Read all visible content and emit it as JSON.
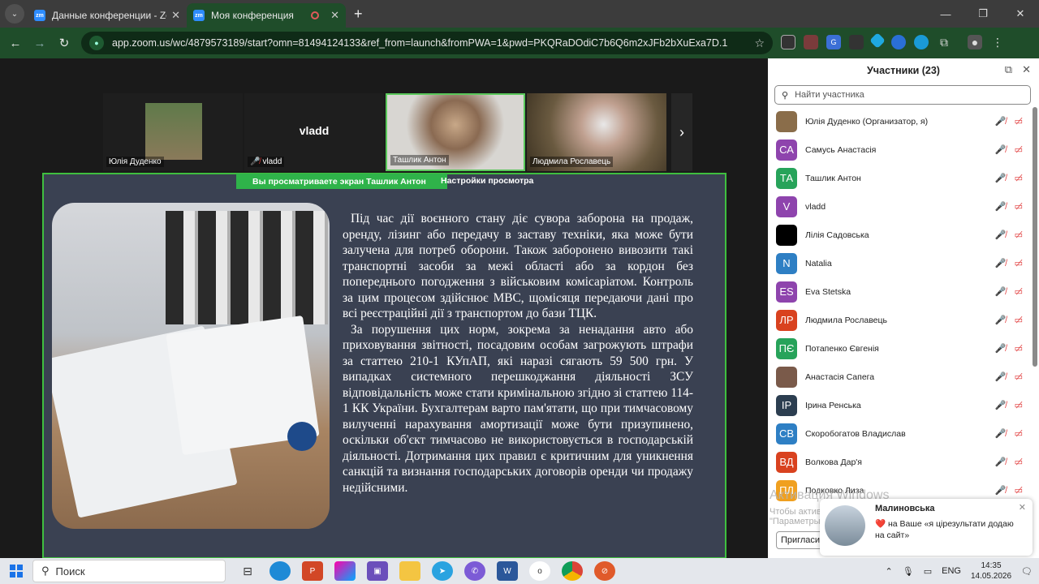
{
  "browser": {
    "tabs": [
      {
        "label": "Данные конференции - Zoom",
        "favicon": "zm"
      },
      {
        "label": "Моя конференция",
        "favicon": "zm"
      }
    ],
    "url": "app.zoom.us/wc/4879573189/start?omn=81494124133&ref_from=launch&fromPWA=1&pwd=PKQRaDOdiC7b6Q6m2xJFb2bXuExa7D.1"
  },
  "meeting": {
    "videos": [
      {
        "name": "Юлія Дуденко"
      },
      {
        "name": "vladd",
        "big": "vladd"
      },
      {
        "name": "Ташлик Антон"
      },
      {
        "name": "Людмила Рославець"
      }
    ],
    "banner": "Вы просматриваете экран  Ташлик Антон",
    "view_options": "Настройки просмотра",
    "paragraph1": "Під час дії воєнного стану діє сувора заборона на продаж, оренду, лізинг або передачу в заставу техніки, яка може бути залучена для потреб оборони. Також заборонено вивозити такі транспортні засоби за межі області або за кордон без попереднього погодження з військовим комісаріатом. Контроль за цим процесом здійснює МВС, щомісяця передаючи дані про всі реєстраційні дії з транспортом до бази ТЦК.",
    "paragraph2": "За порушення цих норм, зокрема за ненадання авто або приховування звітності, посадовим особам загрожують штрафи за статтею 210-1 КУпАП, які наразі сягають 59 500 грн. У випадках системного перешкоджання діяльності ЗСУ відповідальність може стати кримінальною згідно зі статтею 114-1 КК України. Бухгалтерам варто пам'ятати, що при тимчасовому вилученні нарахування амортизації може бути призупинено, оскільки об'єкт тимчасово не використовується в господарській діяльності. Дотримання цих правил є критичним для уникнення санкцій та визнання господарських договорів оренди чи продажу недійсними."
  },
  "participants": {
    "title": "Участники (23)",
    "search_placeholder": "Найти участника",
    "list": [
      {
        "initials": "",
        "name": "Юлія Дуденко (Организатор, я)",
        "color": "#8a6d4a",
        "photo": true
      },
      {
        "initials": "СА",
        "name": "Самусь Анастасія",
        "color": "#8e44ad"
      },
      {
        "initials": "ТА",
        "name": "Ташлик Антон",
        "color": "#27a35a"
      },
      {
        "initials": "V",
        "name": "vladd",
        "color": "#8e44ad"
      },
      {
        "initials": "",
        "name": "Лілія Садовська",
        "color": "#000000"
      },
      {
        "initials": "N",
        "name": "Natalia",
        "color": "#2e7fc4"
      },
      {
        "initials": "ES",
        "name": "Eva Stetska",
        "color": "#8e44ad"
      },
      {
        "initials": "ЛР",
        "name": "Людмила Рославець",
        "color": "#d9421f"
      },
      {
        "initials": "ПЄ",
        "name": "Потапенко Євгенія",
        "color": "#27a35a"
      },
      {
        "initials": "",
        "name": "Анастасія Сапега",
        "color": "#7a5a4a",
        "photo": true
      },
      {
        "initials": "ІР",
        "name": "Ірина Ренська",
        "color": "#2c3e50"
      },
      {
        "initials": "СВ",
        "name": "Скоробогатов Владислав",
        "color": "#2e7fc4"
      },
      {
        "initials": "ВД",
        "name": "Волкова Дар'я",
        "color": "#d9421f"
      },
      {
        "initials": "ПЛ",
        "name": "Подковко Лиза",
        "color": "#f0a020"
      }
    ],
    "invite": "Пригласи"
  },
  "watermark": {
    "line1": "Активация Windows",
    "line2": "Чтобы активировать Windows, перейдите в раздел \"Параметры\"."
  },
  "notification": {
    "name": "Малиновська",
    "message": "❤️ на Ваше «я цірезультати додаю на сайт»"
  },
  "taskbar": {
    "search": "Поиск",
    "lang": "ENG",
    "time": "14:35",
    "date": "14.05.2026"
  }
}
